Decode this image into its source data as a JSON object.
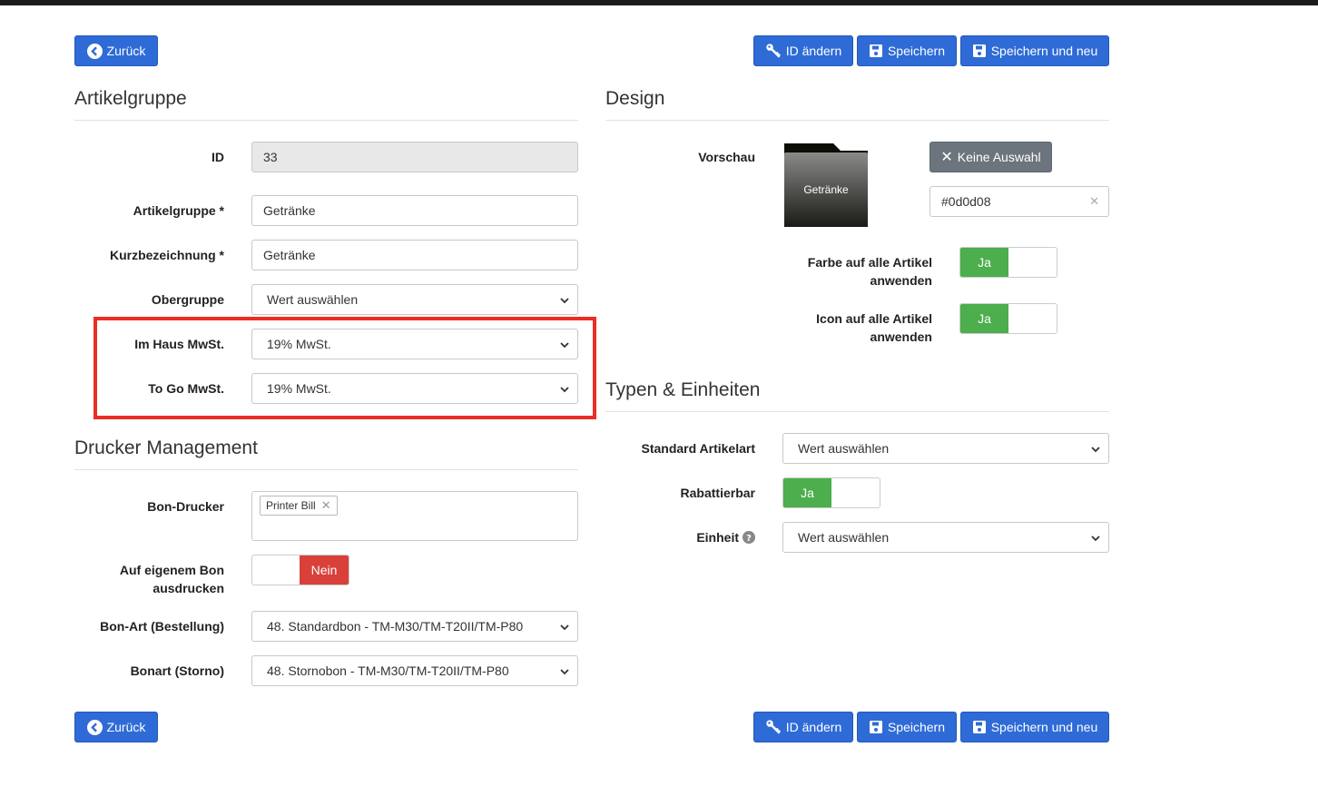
{
  "actions": {
    "back_label": "Zurück",
    "change_id_label": "ID ändern",
    "save_label": "Speichern",
    "save_new_label": "Speichern und neu"
  },
  "artikelgruppe": {
    "title": "Artikelgruppe",
    "id_label": "ID",
    "id_value": "33",
    "name_label": "Artikelgruppe *",
    "name_value": "Getränke",
    "short_label": "Kurzbezeichnung *",
    "short_value": "Getränke",
    "parent_label": "Obergruppe",
    "parent_value": "Wert auswählen",
    "inhouse_vat_label": "Im Haus MwSt.",
    "inhouse_vat_value": "19% MwSt.",
    "togo_vat_label": "To Go MwSt.",
    "togo_vat_value": "19% MwSt."
  },
  "drucker": {
    "title": "Drucker Management",
    "bon_printer_label": "Bon-Drucker",
    "bon_printer_tag": "Printer Bill",
    "own_bon_label_line1": "Auf eigenem Bon",
    "own_bon_label_line2": "ausdrucken",
    "own_bon_toggle": "Nein",
    "bon_order_label": "Bon-Art (Bestellung)",
    "bon_order_value": "48. Standardbon - TM-M30/TM-T20II/TM-P80",
    "bon_storno_label": "Bonart (Storno)",
    "bon_storno_value": "48. Stornobon - TM-M30/TM-T20II/TM-P80"
  },
  "design": {
    "title": "Design",
    "preview_label": "Vorschau",
    "preview_text": "Getränke",
    "no_selection_label": "Keine Auswahl",
    "color_value": "#0d0d08",
    "apply_color_line1": "Farbe auf alle Artikel",
    "apply_color_line2": "anwenden",
    "apply_color_toggle": "Ja",
    "apply_icon_line1": "Icon auf alle Artikel",
    "apply_icon_line2": "anwenden",
    "apply_icon_toggle": "Ja"
  },
  "typen": {
    "title": "Typen & Einheiten",
    "article_type_label": "Standard Artikelart",
    "article_type_value": "Wert auswählen",
    "discount_label": "Rabattierbar",
    "discount_toggle": "Ja",
    "unit_label": "Einheit",
    "unit_value": "Wert auswählen"
  },
  "colors": {
    "primary": "#2e6bd6",
    "success": "#4cae4c",
    "danger": "#d9403a",
    "highlight": "#ea2e23"
  }
}
